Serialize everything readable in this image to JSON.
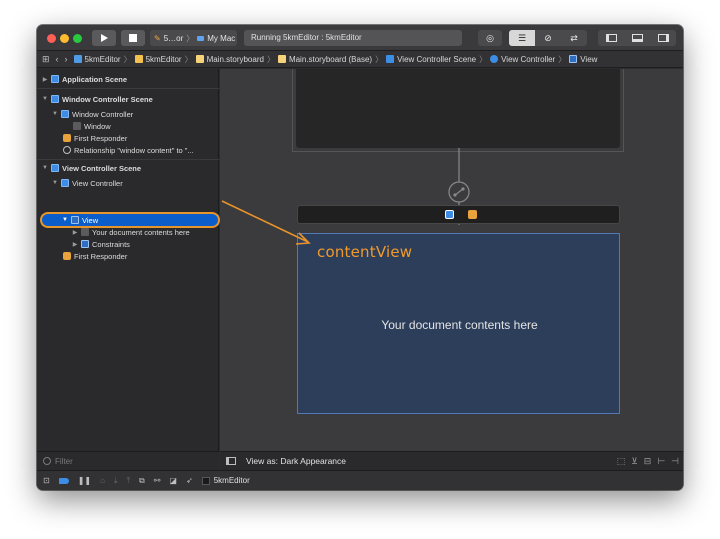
{
  "toolbar": {
    "scheme_label": "5…or",
    "destination_label": "My Mac",
    "status_text": "Running 5kmEditor : 5kmEditor"
  },
  "breadcrumb": {
    "items": [
      {
        "label": "5kmEditor",
        "icon": "project-icon"
      },
      {
        "label": "5kmEditor",
        "icon": "folder-icon"
      },
      {
        "label": "Main.storyboard",
        "icon": "storyboard-file-icon"
      },
      {
        "label": "Main.storyboard (Base)",
        "icon": "storyboard-file-icon"
      },
      {
        "label": "View Controller Scene",
        "icon": "scene-icon"
      },
      {
        "label": "View Controller",
        "icon": "view-controller-icon"
      },
      {
        "label": "View",
        "icon": "view-icon"
      }
    ]
  },
  "outline": {
    "rows": [
      {
        "label": "Application Scene",
        "bold": true,
        "icon": "scene-icon",
        "disclosure": "▶"
      },
      {
        "label": "Window Controller Scene",
        "bold": true,
        "icon": "scene-icon",
        "disclosure": "▼"
      },
      {
        "label": "Window Controller",
        "bold": false,
        "icon": "window-controller-icon",
        "disclosure": "▼"
      },
      {
        "label": "Window",
        "bold": false,
        "icon": "window-icon",
        "disclosure": ""
      },
      {
        "label": "First Responder",
        "bold": false,
        "icon": "first-responder-icon",
        "disclosure": ""
      },
      {
        "label": "Relationship \"window content\" to \"...",
        "bold": false,
        "icon": "relationship-icon",
        "disclosure": ""
      },
      {
        "label": "View Controller Scene",
        "bold": true,
        "icon": "scene-icon",
        "disclosure": "▼"
      },
      {
        "label": "View Controller",
        "bold": false,
        "icon": "view-controller-icon",
        "disclosure": "▼"
      },
      {
        "label": "View",
        "bold": false,
        "icon": "view-icon",
        "disclosure": "▼",
        "selected": true
      },
      {
        "label": "Your document contents here",
        "bold": false,
        "icon": "label-icon",
        "disclosure": "▶"
      },
      {
        "label": "Constraints",
        "bold": false,
        "icon": "constraints-icon",
        "disclosure": "▶"
      },
      {
        "label": "First Responder",
        "bold": false,
        "icon": "first-responder-icon",
        "disclosure": ""
      }
    ],
    "filter_placeholder": "Filter"
  },
  "canvas": {
    "content_text": "Your document contents here",
    "annotation_text": "contentView",
    "annotation_color": "#f09a2c"
  },
  "bottom_bar": {
    "view_as_label": "View as: Dark Appearance"
  },
  "debug_bar": {
    "process_label": "5kmEditor"
  },
  "colors": {
    "selection": "#0b5ec9",
    "highlight": "#e8942a",
    "content_view_bg": "#2d3e5b"
  }
}
